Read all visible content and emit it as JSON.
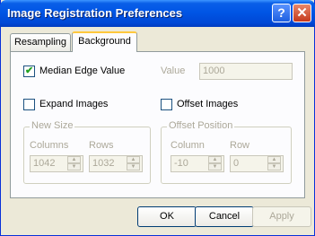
{
  "window": {
    "title": "Image Registration Preferences"
  },
  "titlebar": {
    "help_glyph": "?",
    "close_glyph": "✕"
  },
  "tabs": [
    {
      "label": "Resampling"
    },
    {
      "label": "Background"
    }
  ],
  "background": {
    "median_edge": {
      "label": "Median Edge Value",
      "checked": true
    },
    "value": {
      "label": "Value",
      "value": "1000"
    },
    "expand_images": {
      "label": "Expand Images",
      "checked": false
    },
    "offset_images": {
      "label": "Offset Images",
      "checked": false
    },
    "new_size": {
      "title": "New Size",
      "columns_label": "Columns",
      "columns_value": "1042",
      "rows_label": "Rows",
      "rows_value": "1032"
    },
    "offset_position": {
      "title": "Offset Position",
      "column_label": "Column",
      "column_value": "-10",
      "row_label": "Row",
      "row_value": "0"
    }
  },
  "buttons": {
    "ok": "OK",
    "cancel": "Cancel",
    "apply": "Apply"
  }
}
